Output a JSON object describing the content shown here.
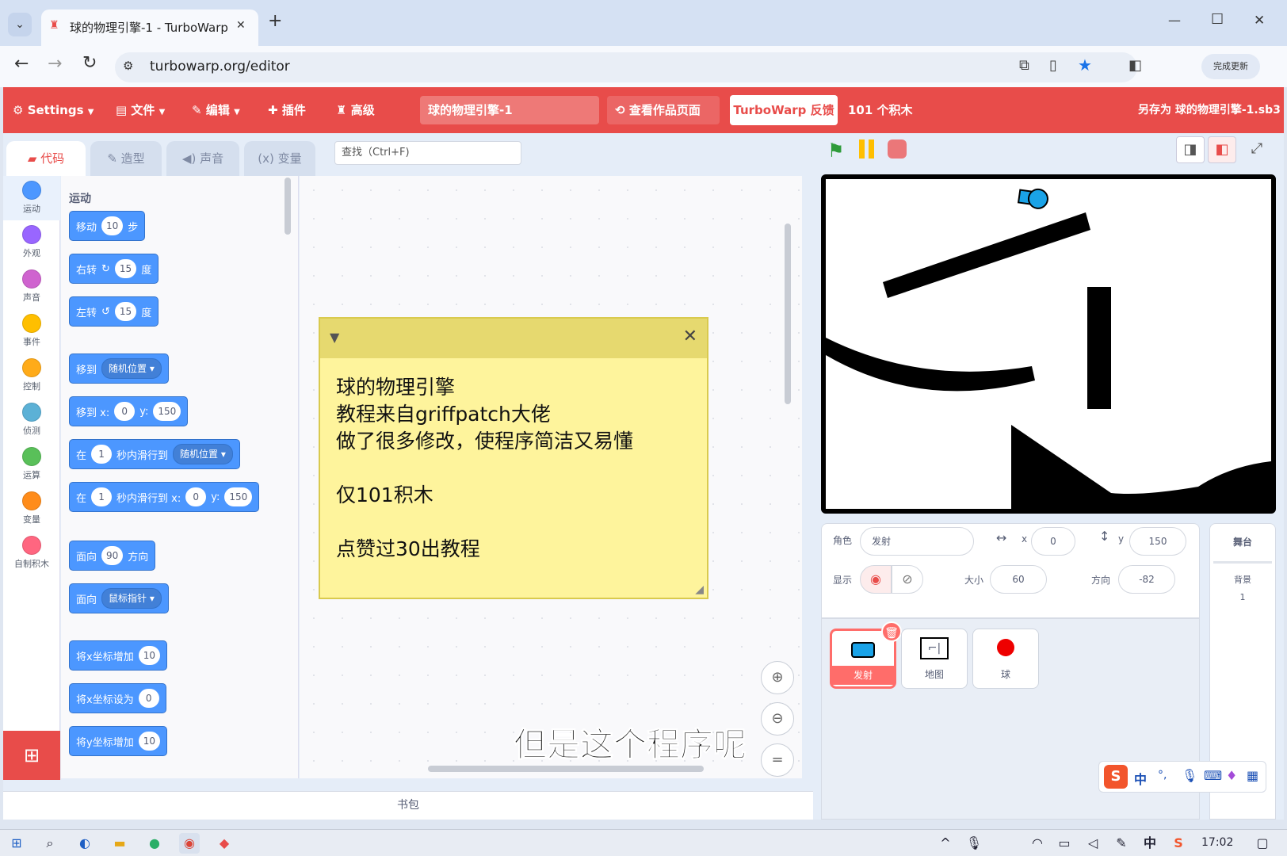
{
  "browser": {
    "tab_title": "球的物理引擎-1 - TurboWarp",
    "tab_close": "✕",
    "new_tab": "+",
    "url": "turbowarp.org/editor",
    "window_controls": [
      "—",
      "☐",
      "✕"
    ],
    "profile_label": "完成更新"
  },
  "menu": {
    "settings": "Settings",
    "file": "文件",
    "edit": "编辑",
    "plugins": "插件",
    "advanced": "高级",
    "project_title": "球的物理引擎-1",
    "see_project": "查看作品页面",
    "feedback": "TurboWarp 反馈",
    "block_count": "101 个积木",
    "save_as": "另存为 球的物理引擎-1.sb3"
  },
  "tabs": {
    "code": "代码",
    "costumes": "造型",
    "sounds": "声音",
    "variables": "变量",
    "search_placeholder": "查找（Ctrl+F)"
  },
  "categories": [
    {
      "label": "运动",
      "color": "#4c97ff"
    },
    {
      "label": "外观",
      "color": "#9966ff"
    },
    {
      "label": "声音",
      "color": "#cf63cf"
    },
    {
      "label": "事件",
      "color": "#ffbf00"
    },
    {
      "label": "控制",
      "color": "#ffab19"
    },
    {
      "label": "侦测",
      "color": "#5cb1d6"
    },
    {
      "label": "运算",
      "color": "#59c059"
    },
    {
      "label": "变量",
      "color": "#ff8c1a"
    },
    {
      "label": "自制积木",
      "color": "#ff6680"
    }
  ],
  "palette": {
    "section": "运动",
    "move": {
      "label": "移动",
      "value": "10",
      "unit": "步"
    },
    "turn_right": {
      "label": "右转",
      "value": "15",
      "unit": "度"
    },
    "turn_left": {
      "label": "左转",
      "value": "15",
      "unit": "度"
    },
    "goto": {
      "label": "移到",
      "dropdown": "随机位置"
    },
    "goto_xy": {
      "label": "移到 x:",
      "x": "0",
      "ylabel": "y:",
      "y": "150"
    },
    "glide": {
      "label": "在",
      "secs": "1",
      "mid": "秒内滑行到",
      "dropdown": "随机位置"
    },
    "glide_xy": {
      "label": "在",
      "secs": "1",
      "mid": "秒内滑行到 x:",
      "x": "0",
      "ylabel": "y:",
      "y": "150"
    },
    "point_dir": {
      "label": "面向",
      "value": "90",
      "unit": "方向"
    },
    "point_towards": {
      "label": "面向",
      "dropdown": "鼠标指针"
    },
    "change_x": {
      "label": "将x坐标增加",
      "value": "10"
    },
    "set_x": {
      "label": "将x坐标设为",
      "value": "0"
    },
    "change_y": {
      "label": "将y坐标增加",
      "value": "10"
    }
  },
  "note": {
    "text": "球的物理引擎\n教程来自griffpatch大佬\n做了很多修改，使程序简洁又易懂\n\n仅101积木\n\n点赞过30出教程",
    "close": "✕"
  },
  "subtitle": "但是这个程序呢",
  "sprite_info": {
    "sprite_label": "角色",
    "sprite_name": "发射",
    "x_label": "x",
    "x": "0",
    "y_label": "y",
    "y": "150",
    "show_label": "显示",
    "size_label": "大小",
    "size": "60",
    "direction_label": "方向",
    "direction": "-82"
  },
  "sprites": [
    {
      "name": "发射",
      "selected": true
    },
    {
      "name": "地图",
      "selected": false
    },
    {
      "name": "球",
      "selected": false
    }
  ],
  "stage_panel": {
    "label": "舞台",
    "backdrops_label": "背景",
    "backdrops_count": "1"
  },
  "backpack": "书包",
  "taskbar": {
    "time": "17:02",
    "ime": "中"
  },
  "ime_bar": [
    "中",
    "°,",
    "🎤",
    "⌨"
  ]
}
